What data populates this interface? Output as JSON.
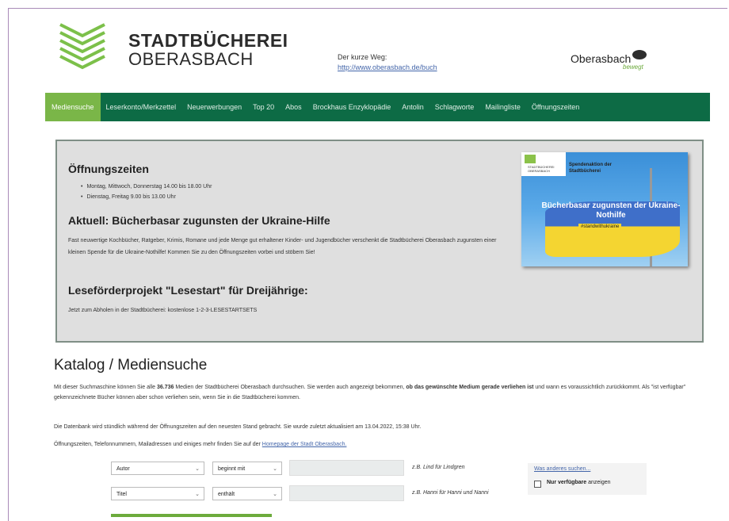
{
  "header": {
    "logo_line1": "STADTBÜCHEREI",
    "logo_line2": "OBERASBACH",
    "short_way_label": "Der kurze Weg:",
    "short_way_url": "http://www.oberasbach.de/buch",
    "town_logo": "Oberasbach",
    "town_logo_sub": "bewegt"
  },
  "nav": {
    "items": [
      "Mediensuche",
      "Leserkonto/Merkzettel",
      "Neuerwerbungen",
      "Top 20",
      "Abos",
      "Brockhaus Enzyklopädie",
      "Antolin",
      "Schlagworte",
      "Mailingliste",
      "Öffnungszeiten"
    ],
    "active_index": 0,
    "bar_color": "#0d6b45",
    "active_color": "#7ab648"
  },
  "info": {
    "opening_heading": "Öffnungszeiten",
    "opening_items": [
      "Montag, Mittwoch, Donnerstag 14.00 bis 18.00 Uhr",
      "Dienstag, Freitag 9.00 bis 13.00 Uhr"
    ],
    "news_heading": "Aktuell: Bücherbasar zugunsten der Ukraine-Hilfe",
    "news_text": "Fast neuwertige Kochbücher, Ratgeber, Krimis, Romane und jede Menge gut erhaltener Kinder- und Jugendbücher verschenkt die Stadtbücherei Oberasbach zugunsten einer kleinen Spende für die Ukraine-Nothilfe! Kommen Sie zu den Öffnungszeiten vorbei und stöbern Sie!",
    "reading_heading": "Leseförderprojekt \"Lesestart\" für Dreijährige:",
    "reading_text": "Jetzt zum Abholen in der Stadtbücherei: kostenlose 1-2-3-LESESTARTSETS",
    "poster": {
      "logo_text": "STADTBÜCHEREI OBERASBACH",
      "title": "Spendenaktion der Stadtbücherei",
      "headline": "Bücherbasar zugunsten der Ukraine-Nothilfe",
      "tag": "#standwithukraine"
    }
  },
  "catalog": {
    "heading": "Katalog / Mediensuche",
    "para1_a": "Mit dieser Suchmaschine können Sie alle ",
    "para1_count": "36.736",
    "para1_b": " Medien der Stadtbücherei Oberasbach durchsuchen. Sie werden auch angezeigt bekommen, ",
    "para1_bold": "ob das gewünschte Medium gerade verliehen ist",
    "para1_c": " und wann es voraussichtlich zurückkommt. Als \"ist verfügbar\" gekennzeichnete Bücher können aber schon verliehen sein, wenn Sie in die Stadtbücherei kommen.",
    "para2": "Die Datenbank wird stündlich während der Öffnungszeiten auf den neuesten Stand gebracht. Sie wurde zuletzt aktualisiert am 13.04.2022, 15:38 Uhr.",
    "para3_a": "Öffnungszeiten, Telefonnummern, Mailadressen und einiges mehr finden Sie auf der ",
    "para3_link": "Homepage der Stadt Oberasbach."
  },
  "search": {
    "row1": {
      "field": "Autor",
      "mode": "beginnt mit",
      "value": "",
      "hint": "z.B. Lind für Lindgren"
    },
    "row2": {
      "field": "Titel",
      "mode": "enthält",
      "value": "",
      "hint": "z.B. Hanni für Hanni und Nanni"
    },
    "other_link": "Was anderes suchen...",
    "available_bold": "Nur verfügbare",
    "available_rest": " anzeigen"
  }
}
